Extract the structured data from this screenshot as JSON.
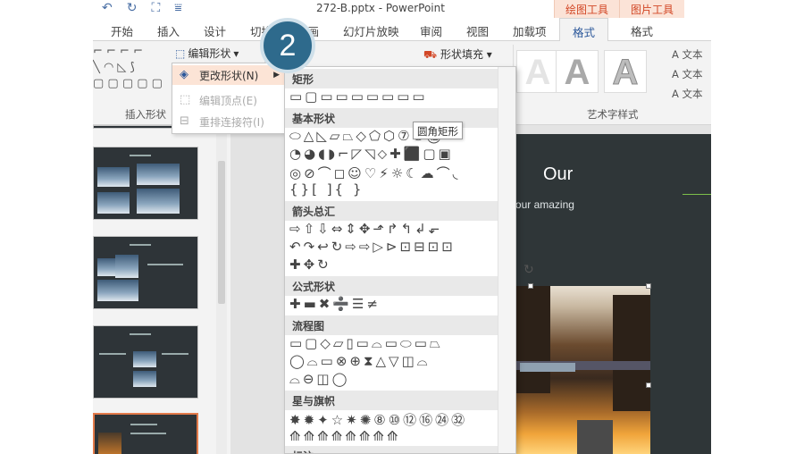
{
  "window": {
    "title": "272-B.pptx - PowerPoint",
    "qat_icons": [
      "undo-icon",
      "redo-icon",
      "slideshow-icon",
      "customize-icon"
    ]
  },
  "context_tabs": {
    "drawing_tools": "绘图工具",
    "picture_tools": "图片工具"
  },
  "tabs": [
    "开始",
    "插入",
    "设计",
    "切换",
    "动画",
    "幻灯片放映",
    "审阅",
    "视图",
    "加载项",
    "格式",
    "格式"
  ],
  "active_tab": "格式",
  "ribbon": {
    "edit_shape": "编辑形状",
    "shape_fill": "形状填充",
    "insert_shapes_label": "插入形状",
    "wordart_label": "艺术字样式",
    "wordart_letter": "A",
    "text_buttons": [
      "A 文本",
      "A 文本",
      "A 文本"
    ]
  },
  "edit_shape_menu": {
    "items": [
      {
        "label": "更改形状(N)",
        "state": "highlighted"
      },
      {
        "label": "编辑顶点(E)",
        "state": "disabled"
      },
      {
        "label": "重排连接符(I)",
        "state": "disabled"
      }
    ]
  },
  "gallery": {
    "sections": [
      {
        "header": "矩形",
        "rows": [
          "▭▢▭▭▭▭▭▭▭"
        ]
      },
      {
        "header": "基本形状",
        "rows": [
          "⬭△◺▱⏢◇⬠⬡⑦⑩⑫",
          "◔◕◖◗⌐◸◹⬦✚⬛▢▣",
          "◎⊘⌒◻☺♡⚡☼☾☁⌒◟",
          "{}[ ]{ }"
        ]
      },
      {
        "header": "箭头总汇",
        "rows": [
          "⇨⇧⇩⇔⇕✥⬏↱↰↲⬐",
          "↶↷↩↻⇨⇨▷⊳⊡⊟⊡⊡",
          "✚✥↻"
        ]
      },
      {
        "header": "公式形状",
        "rows": [
          "✚▬✖➗☰≠"
        ]
      },
      {
        "header": "流程图",
        "rows": [
          "▭▢◇▱▯▭⌓▭⬭▭⏢",
          "◯⌓▭⊗⊕⧗△▽◫⌓",
          "⌓⊖◫◯"
        ]
      },
      {
        "header": "星与旗帜",
        "rows": [
          "✸✹✦☆✷✺⑧⑩⑫⑯㉔㉜",
          "⟰⟰⟰⟰⟰⟰⟰⟰"
        ]
      },
      {
        "header": "标注",
        "rows": []
      }
    ],
    "tooltip": "圆角矩形"
  },
  "step_badge": "2",
  "slide": {
    "title": "Our",
    "subtitle": "Your amazing"
  },
  "colors": {
    "accent": "#d24726",
    "tab_active": "#2b579a",
    "badge": "#2e6a8c",
    "slide_bg": "#2f3638",
    "highlight": "#fce4d6"
  }
}
